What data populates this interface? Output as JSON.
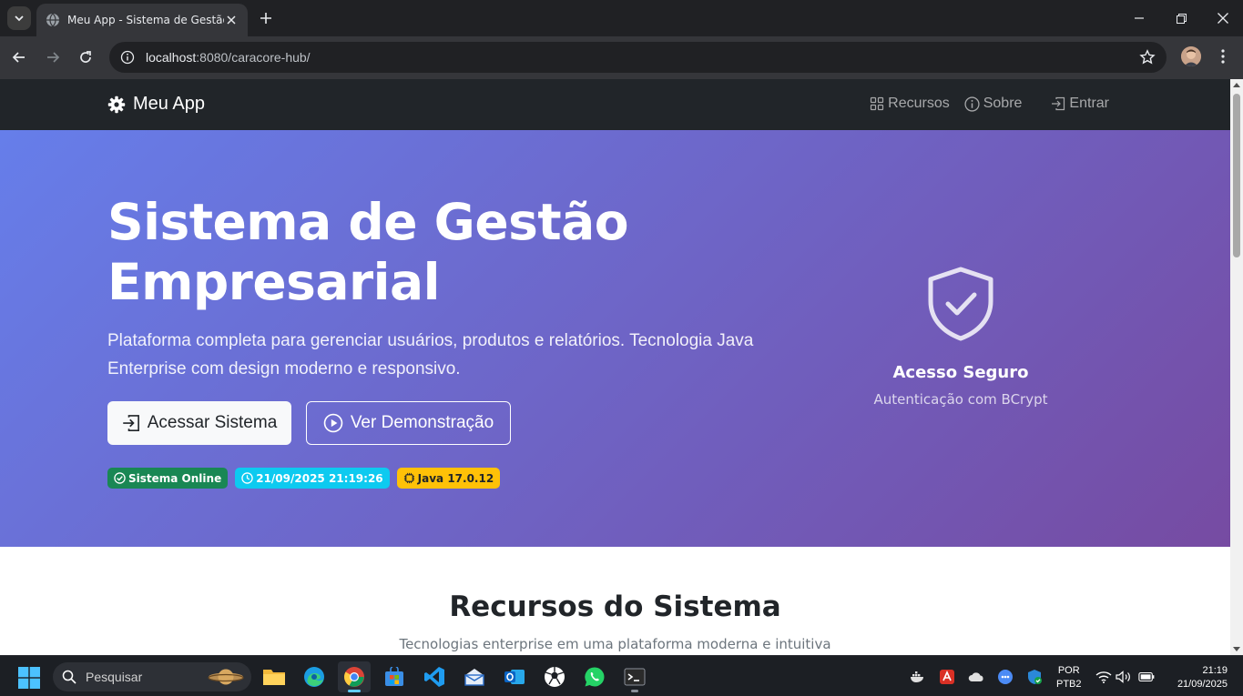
{
  "browser": {
    "tab_title": "Meu App - Sistema de Gestão",
    "url_host": "localhost",
    "url_rest": ":8080/caracore-hub/"
  },
  "app": {
    "brand": "Meu App",
    "nav": {
      "recursos": "Recursos",
      "sobre": "Sobre",
      "entrar": "Entrar"
    }
  },
  "hero": {
    "title_line1": "Sistema de Gestão",
    "title_line2": "Empresarial",
    "lead": "Plataforma completa para gerenciar usuários, produtos e relatórios. Tecnologia Java Enterprise com design moderno e responsivo.",
    "primary_button": "Acessar Sistema",
    "secondary_button": "Ver Demonstração",
    "badges": {
      "status": "Sistema Online",
      "datetime": "21/09/2025 21:19:26",
      "java": "Java 17.0.12"
    },
    "card_title": "Acesso Seguro",
    "card_subtitle": "Autenticação com BCrypt",
    "gradient_start": "#667eea",
    "gradient_end": "#764ba2"
  },
  "features": {
    "title": "Recursos do Sistema",
    "subtitle": "Tecnologias enterprise em uma plataforma moderna e intuitiva"
  },
  "taskbar": {
    "search_placeholder": "Pesquisar",
    "language_line1": "POR",
    "language_line2": "PTB2",
    "time": "21:19",
    "date": "21/09/2025",
    "apps": [
      "file-explorer",
      "edge",
      "chrome",
      "microsoft-store",
      "vscode",
      "mail",
      "outlook",
      "soccer-app",
      "whatsapp",
      "terminal"
    ]
  }
}
